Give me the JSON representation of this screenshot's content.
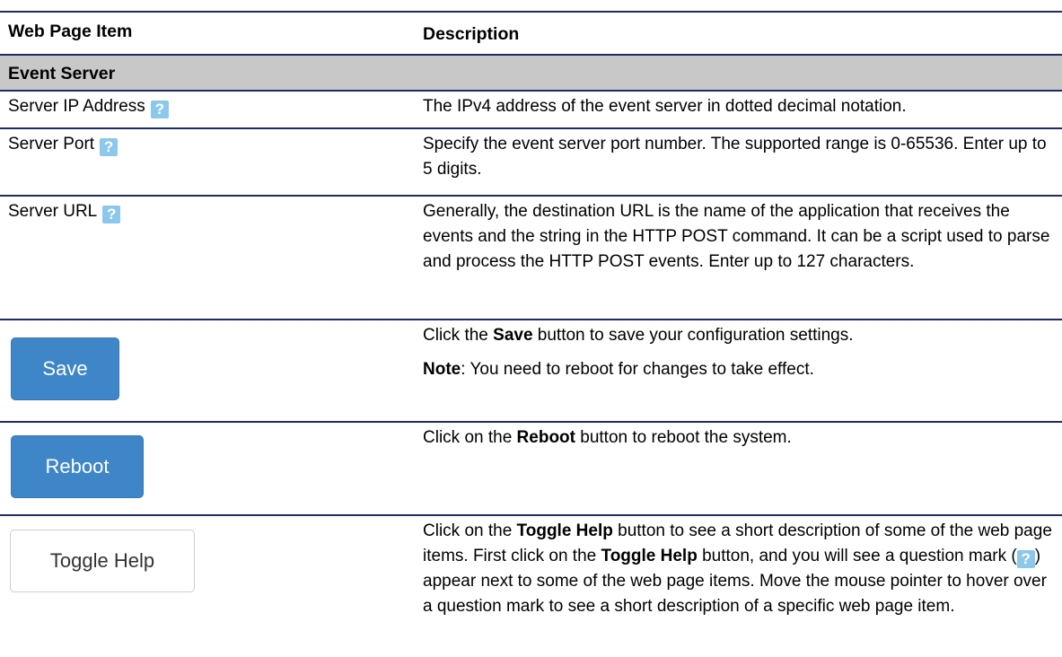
{
  "header": {
    "item_label": "Web Page Item",
    "description_label": "Description"
  },
  "section": {
    "title": "Event Server"
  },
  "rows": [
    {
      "item": "Server IP Address",
      "description": "The IPv4 address of the event server in dotted decimal notation."
    },
    {
      "item": "Server Port",
      "description": "Specify the event server port number. The supported range is 0-65536. Enter up to 5 digits."
    },
    {
      "item": "Server URL",
      "description": "Generally, the destination URL is the name of the application that receives the events and the string in the HTTP POST command. It can be a script used to parse and process the HTTP POST events. Enter up to 127 characters."
    }
  ],
  "help_icon_glyph": "?",
  "save": {
    "button_label": "Save",
    "desc_prefix": "Click the ",
    "desc_bold": "Save",
    "desc_suffix": " button to save your configuration settings.",
    "note_bold": "Note",
    "note_text": ": You need to reboot for changes to take effect."
  },
  "reboot": {
    "button_label": "Reboot",
    "desc_prefix": "Click on the ",
    "desc_bold": "Reboot",
    "desc_suffix": " button to reboot the system."
  },
  "toggle": {
    "button_label": "Toggle Help",
    "desc_part1": "Click on the ",
    "desc_bold1": "Toggle Help",
    "desc_part2": " button to see a short description of some of the web page items. First click on the ",
    "desc_bold2": "Toggle Help",
    "desc_part3": " button, and you will see a question mark (",
    "desc_part4": ") appear next to some of the web page items. Move the mouse pointer to hover over a question mark to see a short description of a specific web page item."
  },
  "colors": {
    "rule": "#1f2b66",
    "section_bg": "#c8c8c8",
    "help_icon_bg": "#8cc8ec",
    "primary_button": "#3e86c8"
  }
}
